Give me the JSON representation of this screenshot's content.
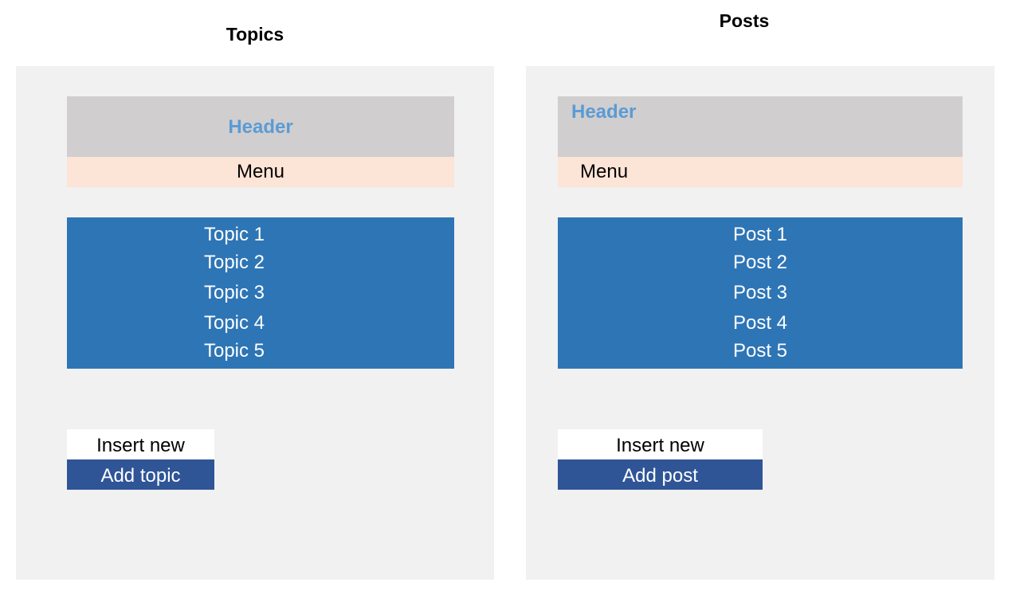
{
  "topics": {
    "title": "Topics",
    "header_label": "Header",
    "menu_label": "Menu",
    "items": [
      "Topic 1",
      "Topic 2",
      "Topic 3",
      "Topic 4",
      "Topic 5"
    ],
    "insert_label": "Insert new",
    "add_label": "Add topic"
  },
  "posts": {
    "title": "Posts",
    "header_label": "Header",
    "menu_label": "Menu",
    "items": [
      "Post 1",
      "Post 2",
      "Post 3",
      "Post 4",
      "Post 5"
    ],
    "insert_label": "Insert new",
    "add_label": "Add post"
  },
  "colors": {
    "panel_bg": "#f1f1f1",
    "header_bg": "#d0cece",
    "header_text": "#5b9bd5",
    "menu_bg": "#fce4d6",
    "list_bg": "#2e75b6",
    "add_button_bg": "#2f5597"
  }
}
